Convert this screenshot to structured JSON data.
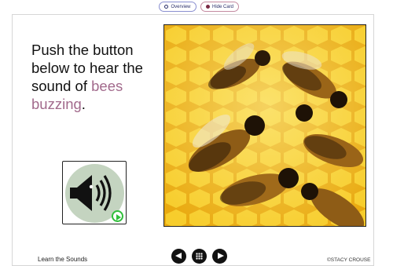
{
  "toolbar": {
    "overview_label": "Overview",
    "hide_card_label": "Hide Card"
  },
  "card": {
    "prompt": {
      "text_before": "Push the button below to hear the sound of ",
      "highlight": "bees buzzing",
      "text_after": "."
    },
    "sound_button": {
      "icon": "speaker-icon",
      "badge_icon": "play-icon"
    },
    "photo": {
      "subject": "bees"
    }
  },
  "footer": {
    "deck_title": "Learn the Sounds",
    "credit": "©STACY CROUSE",
    "nav": {
      "prev_icon": "prev-arrow-icon",
      "grid_icon": "grid-icon",
      "next_icon": "next-arrow-icon"
    }
  },
  "colors": {
    "highlight": "#a26a8c",
    "sound_circle": "#c4d4c0",
    "play_badge": "#2fbf3a",
    "honeycomb": "#f3c21a"
  }
}
